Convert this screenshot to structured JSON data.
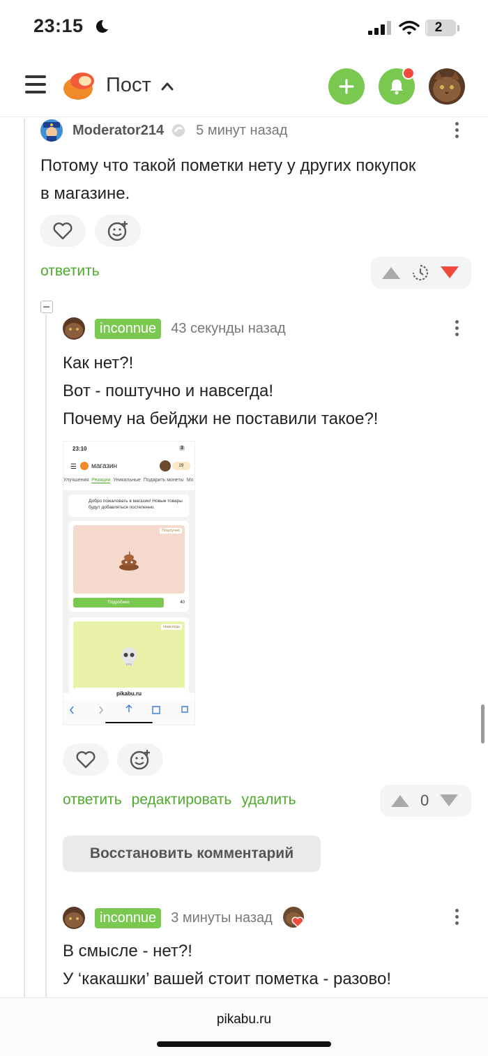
{
  "status_bar": {
    "time": "23:15",
    "battery": "2",
    "battery_level": 0.12
  },
  "header": {
    "title": "Пост"
  },
  "comments": [
    {
      "author": "Moderator214",
      "time": "5 минут назад",
      "lines": [
        "Потому что такой пометки нету у других покупок",
        "в магазине."
      ],
      "actions": [
        "ответить"
      ],
      "vote_count": ""
    },
    {
      "author": "inconnue",
      "time": "43 секунды назад",
      "lines": [
        "Как нет?!",
        "Вот - поштучно и навсегда!",
        "Почему на бейджи не поставили такое?!"
      ],
      "actions": [
        "ответить",
        "редактировать",
        "удалить"
      ],
      "vote_count": "0",
      "restore_label": "Восстановить комментарий"
    },
    {
      "author": "inconnue",
      "time": "3 минуты назад",
      "lines": [
        "В смысле - нет?!",
        "У ‘какашки’ вашей стоит пометка - разово!"
      ]
    }
  ],
  "attachment": {
    "status_time": "23:10",
    "status_battery": "3",
    "title": "магазин",
    "coins": "29",
    "tabs": [
      "Улучшения",
      "Реакции",
      "Уникальные",
      "Подарить монеты",
      "Мо"
    ],
    "active_tab": "Реакции",
    "welcome": "Добро пожаловать в магазин! Новые товары будут добавляться постепенно.",
    "card1_tag": "Поштучно",
    "card1_button": "Подробнее",
    "card1_price": "40",
    "card2_tag": "Навсегда",
    "url": "pikabu.ru"
  },
  "footer": {
    "url": "pikabu.ru"
  },
  "colors": {
    "accent": "#7bc850",
    "link": "#4eaa2c",
    "downvote": "#ef4a3c",
    "notification": "#ef4a3c"
  }
}
